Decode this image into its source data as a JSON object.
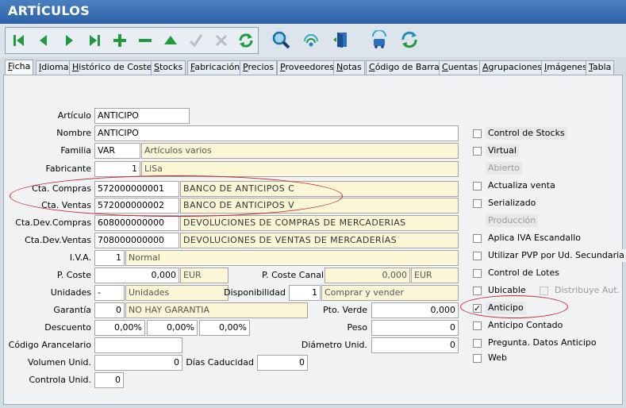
{
  "window": {
    "title": "ARTÍCULOS"
  },
  "toolbar": {
    "nav": [
      {
        "name": "first-record-icon"
      },
      {
        "name": "prev-record-icon"
      },
      {
        "name": "next-record-icon"
      },
      {
        "name": "last-record-icon"
      },
      {
        "name": "add-icon"
      },
      {
        "name": "delete-icon"
      },
      {
        "name": "edit-icon"
      },
      {
        "name": "confirm-icon"
      },
      {
        "name": "cancel-icon"
      },
      {
        "name": "refresh-icon"
      }
    ],
    "tools": [
      {
        "name": "search-icon"
      },
      {
        "name": "signal-icon"
      },
      {
        "name": "exit-door-icon"
      }
    ],
    "extra": [
      {
        "name": "transport-icon"
      },
      {
        "name": "sync-icon"
      }
    ]
  },
  "tabs": [
    {
      "u": "F",
      "rest": "icha"
    },
    {
      "u": "I",
      "rest": "dioma"
    },
    {
      "u": "H",
      "rest": "istórico de Costes"
    },
    {
      "u": "S",
      "rest": "tocks"
    },
    {
      "u": "F",
      "rest": "abricación"
    },
    {
      "u": "P",
      "rest": "recios"
    },
    {
      "u": "P",
      "rest": "roveedores"
    },
    {
      "u": "N",
      "rest": "otas"
    },
    {
      "u": "C",
      "rest": "ódigo de Barras"
    },
    {
      "u": "C",
      "rest": "uentas"
    },
    {
      "u": "A",
      "rest": "grupaciones"
    },
    {
      "u": "I",
      "rest": "mágenes"
    },
    {
      "u": "T",
      "rest": "abla"
    }
  ],
  "labels": {
    "articulo": "Artículo",
    "nombre": "Nombre",
    "familia": "Familia",
    "fabricante": "Fabricante",
    "cta_compras": "Cta. Compras",
    "cta_ventas": "Cta. Ventas",
    "cta_dev_compras": "Cta.Dev.Compras",
    "cta_dev_ventas": "Cta.Dev.Ventas",
    "iva": "I.V.A.",
    "p_coste": "P. Coste",
    "p_coste_canal": "P. Coste Canal",
    "unidades": "Unidades",
    "disponibilidad": "Disponibilidad",
    "garantia": "Garantía",
    "pto_verde": "Pto. Verde",
    "descuento": "Descuento",
    "peso": "Peso",
    "codigo_arancelario": "Código Arancelario",
    "diametro": "Diámetro Unid.",
    "volumen": "Volumen Unid.",
    "dias_caducidad": "Días Caducidad",
    "controla_unid": "Controla Unid."
  },
  "values": {
    "articulo": "ANTICIPO",
    "nombre": "ANTICIPO",
    "familia_code": "VAR",
    "familia_desc": "Artículos varios",
    "fabricante_code": "1",
    "fabricante_desc": "LiSa",
    "cta_compras": "572000000001",
    "cta_compras_desc": "BANCO DE ANTICIPOS C",
    "cta_ventas": "572000000002",
    "cta_ventas_desc": "BANCO DE ANTICIPOS V",
    "cta_dev_compras": "608000000000",
    "cta_dev_compras_desc": "DEVOLUCIONES DE COMPRAS DE MERCADERIAS",
    "cta_dev_ventas": "708000000000",
    "cta_dev_ventas_desc": "DEVOLUCIONES DE VENTAS DE MERCADERÍAS",
    "iva_code": "1",
    "iva_desc": "Normal",
    "p_coste": "0,000",
    "p_coste_currency": "EUR",
    "p_coste_canal": "0,000",
    "p_coste_canal_currency": "EUR",
    "unidades_code": "-",
    "unidades_desc": "Unidades",
    "disponibilidad_code": "1",
    "disponibilidad_desc": "Comprar y vender",
    "garantia_code": "0",
    "garantia_desc": "NO HAY GARANTIA",
    "pto_verde": "0,000",
    "descuento_1": "0,00%",
    "descuento_2": "0,00%",
    "descuento_3": "0,00%",
    "peso": "0",
    "codigo_arancelario": "",
    "diametro": "0",
    "volumen": "0",
    "dias_caducidad": "0",
    "controla_unid": "0"
  },
  "checks": {
    "control_stocks": {
      "label": "Control de Stocks",
      "checked": false
    },
    "virtual": {
      "label": "Virtual",
      "checked": false
    },
    "abierto": {
      "label": "Abierto",
      "checked": false
    },
    "actualiza_venta": {
      "label": "Actualiza venta",
      "checked": false
    },
    "serializado": {
      "label": "Serializado",
      "checked": false
    },
    "produccion": {
      "label": "Producción",
      "checked": false
    },
    "aplica_iva": {
      "label": "Aplica IVA Escandallo",
      "checked": false
    },
    "utilizar_pvp": {
      "label": "Utilizar PVP por Ud. Secundaria",
      "checked": false
    },
    "control_lotes": {
      "label": "Control de Lotes",
      "checked": false
    },
    "ubicable": {
      "label": "Ubicable",
      "checked": false
    },
    "distribuye": {
      "label": "Distribuye Aut.",
      "checked": false
    },
    "anticipo": {
      "label": "Anticipo",
      "checked": true
    },
    "anticipo_contado": {
      "label": "Anticipo Contado",
      "checked": false
    },
    "pregunta_datos": {
      "label": "Pregunta. Datos Anticipo",
      "checked": false
    },
    "web": {
      "label": "Web",
      "checked": false
    }
  },
  "colors": {
    "annotation": "#c8262b",
    "title_bg": "#2d62a8",
    "toolbar_icon": "#1f9a3c"
  }
}
